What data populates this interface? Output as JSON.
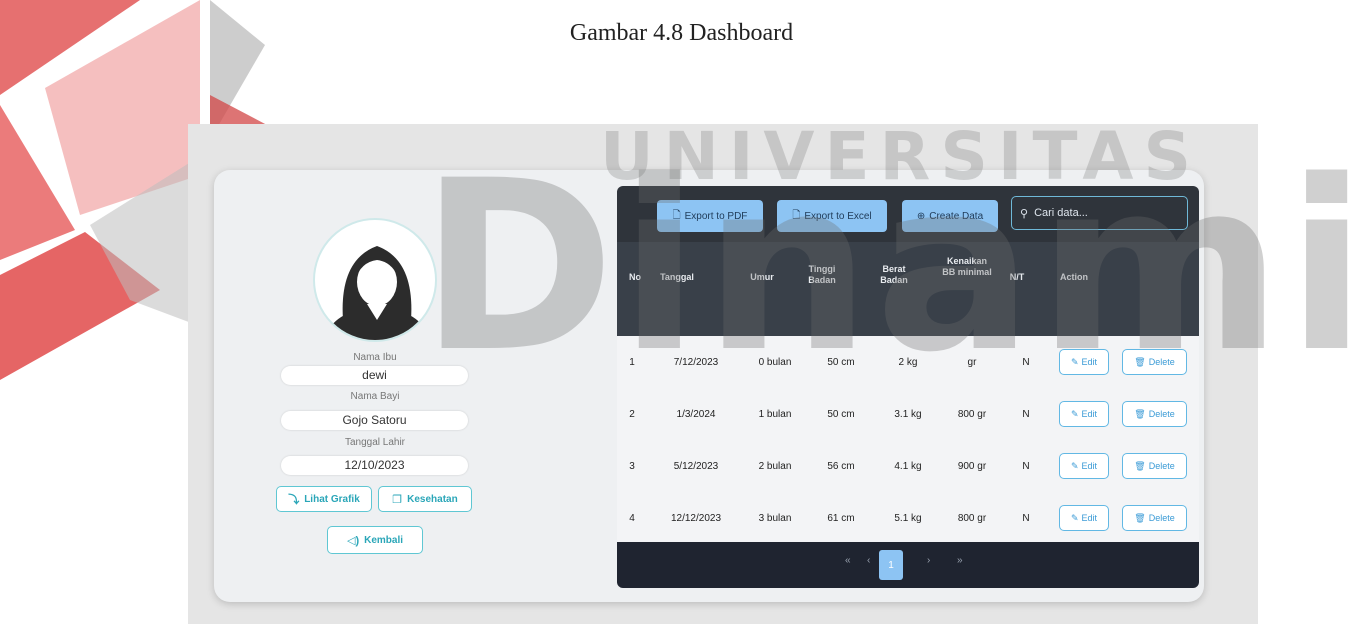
{
  "caption": "Gambar 4.8 Dashboard",
  "watermark": {
    "line1": "UNIVERSITAS",
    "line2": "Dinamika",
    "colors": {
      "red": "#e04a4a",
      "gray": "#a7a7a7"
    }
  },
  "profile": {
    "nama_ibu_label": "Nama Ibu",
    "nama_ibu": "dewi",
    "nama_bayi_label": "Nama Bayi",
    "nama_bayi": "Gojo Satoru",
    "tanggal_lahir_label": "Tanggal Lahir",
    "tanggal_lahir": "12/10/2023",
    "lihat_grafik": "Lihat Grafik",
    "kesehatan": "Kesehatan",
    "kembali": "Kembali"
  },
  "toolbar": {
    "export_pdf": "Export to PDF",
    "export_excel": "Export to Excel",
    "create": "Create Data",
    "search_placeholder": "Cari data..."
  },
  "columns": {
    "no": "No",
    "tanggal": "Tanggal",
    "umur": "Umur",
    "tinggi": "Tinggi Badan",
    "berat": "Berat Badan",
    "kenaikan": "Kenaikan BB minimal",
    "nt": "N/T",
    "action": "Action"
  },
  "rows": [
    {
      "no": "1",
      "tanggal": "7/12/2023",
      "umur": "0 bulan",
      "tinggi": "50 cm",
      "berat": "2 kg",
      "kenaikan": "gr",
      "nt": "N"
    },
    {
      "no": "2",
      "tanggal": "1/3/2024",
      "umur": "1 bulan",
      "tinggi": "50 cm",
      "berat": "3.1 kg",
      "kenaikan": "800 gr",
      "nt": "N"
    },
    {
      "no": "3",
      "tanggal": "5/12/2023",
      "umur": "2 bulan",
      "tinggi": "56 cm",
      "berat": "4.1 kg",
      "kenaikan": "900 gr",
      "nt": "N"
    },
    {
      "no": "4",
      "tanggal": "12/12/2023",
      "umur": "3 bulan",
      "tinggi": "61 cm",
      "berat": "5.1 kg",
      "kenaikan": "800 gr",
      "nt": "N"
    }
  ],
  "actions": {
    "edit": "Edit",
    "delete": "Delete"
  },
  "pagination": {
    "first": "«",
    "prev": "‹",
    "current": "1",
    "next": "›",
    "last": "»"
  },
  "colors": {
    "accent": "#8dc4f3",
    "teal": "#2aa6b8",
    "header_dark": "#394049",
    "footer_dark": "#1f2430"
  }
}
